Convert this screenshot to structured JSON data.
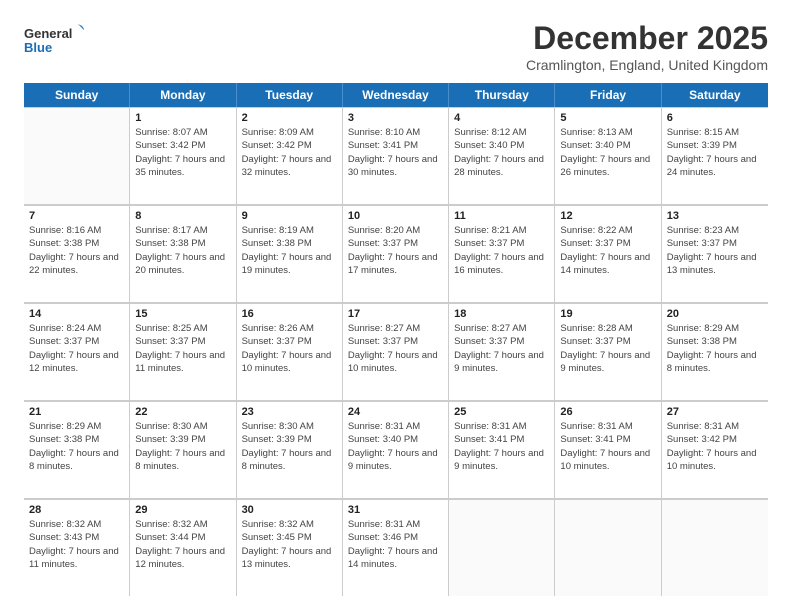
{
  "header": {
    "logo_line1": "General",
    "logo_line2": "Blue",
    "month_title": "December 2025",
    "location": "Cramlington, England, United Kingdom"
  },
  "days_of_week": [
    "Sunday",
    "Monday",
    "Tuesday",
    "Wednesday",
    "Thursday",
    "Friday",
    "Saturday"
  ],
  "weeks": [
    [
      {
        "day": "",
        "empty": true
      },
      {
        "day": "1",
        "sunrise": "Sunrise: 8:07 AM",
        "sunset": "Sunset: 3:42 PM",
        "daylight": "Daylight: 7 hours and 35 minutes."
      },
      {
        "day": "2",
        "sunrise": "Sunrise: 8:09 AM",
        "sunset": "Sunset: 3:42 PM",
        "daylight": "Daylight: 7 hours and 32 minutes."
      },
      {
        "day": "3",
        "sunrise": "Sunrise: 8:10 AM",
        "sunset": "Sunset: 3:41 PM",
        "daylight": "Daylight: 7 hours and 30 minutes."
      },
      {
        "day": "4",
        "sunrise": "Sunrise: 8:12 AM",
        "sunset": "Sunset: 3:40 PM",
        "daylight": "Daylight: 7 hours and 28 minutes."
      },
      {
        "day": "5",
        "sunrise": "Sunrise: 8:13 AM",
        "sunset": "Sunset: 3:40 PM",
        "daylight": "Daylight: 7 hours and 26 minutes."
      },
      {
        "day": "6",
        "sunrise": "Sunrise: 8:15 AM",
        "sunset": "Sunset: 3:39 PM",
        "daylight": "Daylight: 7 hours and 24 minutes."
      }
    ],
    [
      {
        "day": "7",
        "sunrise": "Sunrise: 8:16 AM",
        "sunset": "Sunset: 3:38 PM",
        "daylight": "Daylight: 7 hours and 22 minutes."
      },
      {
        "day": "8",
        "sunrise": "Sunrise: 8:17 AM",
        "sunset": "Sunset: 3:38 PM",
        "daylight": "Daylight: 7 hours and 20 minutes."
      },
      {
        "day": "9",
        "sunrise": "Sunrise: 8:19 AM",
        "sunset": "Sunset: 3:38 PM",
        "daylight": "Daylight: 7 hours and 19 minutes."
      },
      {
        "day": "10",
        "sunrise": "Sunrise: 8:20 AM",
        "sunset": "Sunset: 3:37 PM",
        "daylight": "Daylight: 7 hours and 17 minutes."
      },
      {
        "day": "11",
        "sunrise": "Sunrise: 8:21 AM",
        "sunset": "Sunset: 3:37 PM",
        "daylight": "Daylight: 7 hours and 16 minutes."
      },
      {
        "day": "12",
        "sunrise": "Sunrise: 8:22 AM",
        "sunset": "Sunset: 3:37 PM",
        "daylight": "Daylight: 7 hours and 14 minutes."
      },
      {
        "day": "13",
        "sunrise": "Sunrise: 8:23 AM",
        "sunset": "Sunset: 3:37 PM",
        "daylight": "Daylight: 7 hours and 13 minutes."
      }
    ],
    [
      {
        "day": "14",
        "sunrise": "Sunrise: 8:24 AM",
        "sunset": "Sunset: 3:37 PM",
        "daylight": "Daylight: 7 hours and 12 minutes."
      },
      {
        "day": "15",
        "sunrise": "Sunrise: 8:25 AM",
        "sunset": "Sunset: 3:37 PM",
        "daylight": "Daylight: 7 hours and 11 minutes."
      },
      {
        "day": "16",
        "sunrise": "Sunrise: 8:26 AM",
        "sunset": "Sunset: 3:37 PM",
        "daylight": "Daylight: 7 hours and 10 minutes."
      },
      {
        "day": "17",
        "sunrise": "Sunrise: 8:27 AM",
        "sunset": "Sunset: 3:37 PM",
        "daylight": "Daylight: 7 hours and 10 minutes."
      },
      {
        "day": "18",
        "sunrise": "Sunrise: 8:27 AM",
        "sunset": "Sunset: 3:37 PM",
        "daylight": "Daylight: 7 hours and 9 minutes."
      },
      {
        "day": "19",
        "sunrise": "Sunrise: 8:28 AM",
        "sunset": "Sunset: 3:37 PM",
        "daylight": "Daylight: 7 hours and 9 minutes."
      },
      {
        "day": "20",
        "sunrise": "Sunrise: 8:29 AM",
        "sunset": "Sunset: 3:38 PM",
        "daylight": "Daylight: 7 hours and 8 minutes."
      }
    ],
    [
      {
        "day": "21",
        "sunrise": "Sunrise: 8:29 AM",
        "sunset": "Sunset: 3:38 PM",
        "daylight": "Daylight: 7 hours and 8 minutes."
      },
      {
        "day": "22",
        "sunrise": "Sunrise: 8:30 AM",
        "sunset": "Sunset: 3:39 PM",
        "daylight": "Daylight: 7 hours and 8 minutes."
      },
      {
        "day": "23",
        "sunrise": "Sunrise: 8:30 AM",
        "sunset": "Sunset: 3:39 PM",
        "daylight": "Daylight: 7 hours and 8 minutes."
      },
      {
        "day": "24",
        "sunrise": "Sunrise: 8:31 AM",
        "sunset": "Sunset: 3:40 PM",
        "daylight": "Daylight: 7 hours and 9 minutes."
      },
      {
        "day": "25",
        "sunrise": "Sunrise: 8:31 AM",
        "sunset": "Sunset: 3:41 PM",
        "daylight": "Daylight: 7 hours and 9 minutes."
      },
      {
        "day": "26",
        "sunrise": "Sunrise: 8:31 AM",
        "sunset": "Sunset: 3:41 PM",
        "daylight": "Daylight: 7 hours and 10 minutes."
      },
      {
        "day": "27",
        "sunrise": "Sunrise: 8:31 AM",
        "sunset": "Sunset: 3:42 PM",
        "daylight": "Daylight: 7 hours and 10 minutes."
      }
    ],
    [
      {
        "day": "28",
        "sunrise": "Sunrise: 8:32 AM",
        "sunset": "Sunset: 3:43 PM",
        "daylight": "Daylight: 7 hours and 11 minutes."
      },
      {
        "day": "29",
        "sunrise": "Sunrise: 8:32 AM",
        "sunset": "Sunset: 3:44 PM",
        "daylight": "Daylight: 7 hours and 12 minutes."
      },
      {
        "day": "30",
        "sunrise": "Sunrise: 8:32 AM",
        "sunset": "Sunset: 3:45 PM",
        "daylight": "Daylight: 7 hours and 13 minutes."
      },
      {
        "day": "31",
        "sunrise": "Sunrise: 8:31 AM",
        "sunset": "Sunset: 3:46 PM",
        "daylight": "Daylight: 7 hours and 14 minutes."
      },
      {
        "day": "",
        "empty": true
      },
      {
        "day": "",
        "empty": true
      },
      {
        "day": "",
        "empty": true
      }
    ]
  ]
}
